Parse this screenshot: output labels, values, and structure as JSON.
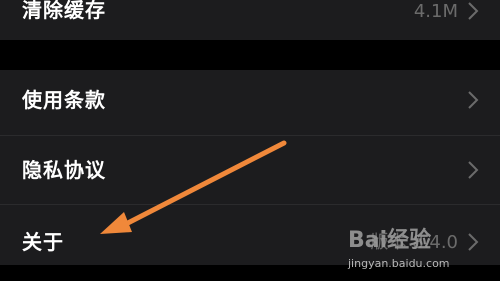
{
  "settings": {
    "items": [
      {
        "label": "清除缓存",
        "value": "4.1M"
      },
      {
        "label": "使用条款",
        "value": ""
      },
      {
        "label": "隐私协议",
        "value": ""
      },
      {
        "label": "关于",
        "value": "版本 8.4.0"
      }
    ]
  },
  "annotation": {
    "arrow_color": "#f0883a"
  },
  "watermark": {
    "logo_text": "Bai经验",
    "url": "jingyan.baidu.com"
  },
  "icons": {
    "chevron": "chevron-right-icon"
  }
}
